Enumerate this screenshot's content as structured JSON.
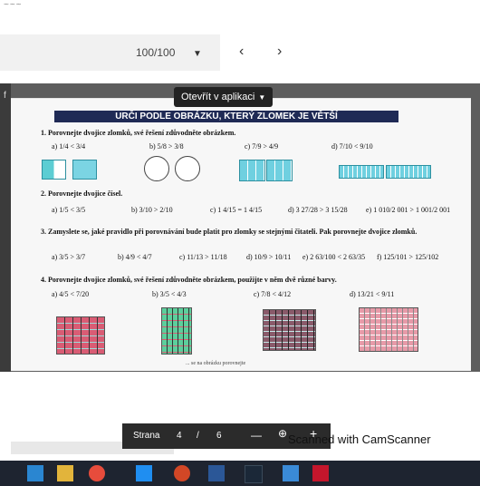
{
  "browser": {
    "top_glyph": "~~~",
    "page_counter": "100/100",
    "dropdown_icon": "triangle-down-icon",
    "prev_icon": "chevron-left-icon",
    "next_icon": "chevron-right-icon"
  },
  "viewer": {
    "open_in_app_label": "Otevřít v aplikaci",
    "left_edge_glyph": "f",
    "header_text": "URČI PODLE OBRÁZKU, KTERÝ ZLOMEK JE VĚTŠÍ"
  },
  "worksheet": {
    "task1": "1. Porovnejte dvojice zlomků, své řešení zdůvodněte obrázkem.",
    "task1_items": [
      "a) 1/4 < 3/4",
      "b) 5/8 > 3/8",
      "c) 7/9 > 4/9",
      "d) 7/10 < 9/10"
    ],
    "task2": "2. Porovnejte dvojice čísel.",
    "task2_items": [
      "a) 1/5 < 3/5",
      "b) 3/10 > 2/10",
      "c) 1 4/15 = 1 4/15",
      "d) 3 27/28 > 3 15/28",
      "e) 1 010/2 001 > 1 001/2 001"
    ],
    "task3": "3. Zamyslete se, jaké pravidlo při porovnávání bude platit pro zlomky se stejnými čitateli. Pak porovnejte dvojice zlomků.",
    "task3_items": [
      "a) 3/5 > 3/7",
      "b) 4/9 < 4/7",
      "c) 11/13 > 11/18",
      "d) 10/9 > 10/11",
      "e) 2 63/100 < 2 63/35",
      "f) 125/101 > 125/102"
    ],
    "task4": "4. Porovnejte dvojice zlomků, své řešení zdůvodněte obrázkem, použijte v něm dvě různé barvy.",
    "task4_items": [
      "a) 4/5 < 7/20",
      "b) 3/5 < 4/3",
      "c) 7/8 < 4/12",
      "d) 13/21 < 9/11"
    ],
    "footer_partial": "... se na obrázku porovnejte"
  },
  "pagebar": {
    "label": "Strana",
    "current": "4",
    "separator": "/",
    "total": "6",
    "minus_icon": "minus-icon",
    "zoom_icon": "zoom-in-icon",
    "plus_icon": "plus-icon"
  },
  "watermark": {
    "text": "Scanned with CamScanner"
  },
  "taskbar": {
    "icons": [
      "mail-icon",
      "folder-icon",
      "chrome-icon",
      "chat-icon",
      "powerpoint-icon",
      "word-icon",
      "steam-icon",
      "photos-icon",
      "acrobat-icon"
    ]
  }
}
